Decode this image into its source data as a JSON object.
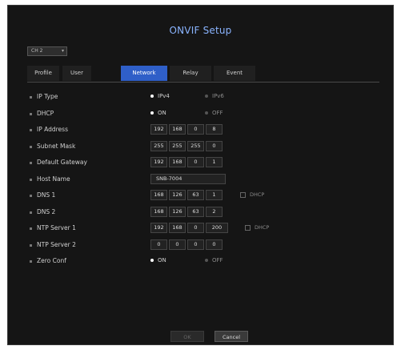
{
  "window": {
    "title": "ONVIF Setup"
  },
  "channel_select": {
    "value": "CH 2"
  },
  "tabs": [
    {
      "label": "Profile",
      "active": false
    },
    {
      "label": "User",
      "active": false
    },
    {
      "label": "Network",
      "active": true
    },
    {
      "label": "Relay",
      "active": false
    },
    {
      "label": "Event",
      "active": false
    }
  ],
  "form": {
    "ip_type": {
      "label": "IP Type",
      "opt1": "IPv4",
      "opt2": "IPv6",
      "selected": "IPv4"
    },
    "dhcp": {
      "label": "DHCP",
      "opt1": "ON",
      "opt2": "OFF",
      "selected": "ON"
    },
    "ip_address": {
      "label": "IP Address",
      "octets": [
        "192",
        "168",
        "0",
        "8"
      ]
    },
    "subnet_mask": {
      "label": "Subnet Mask",
      "octets": [
        "255",
        "255",
        "255",
        "0"
      ]
    },
    "default_gateway": {
      "label": "Default Gateway",
      "octets": [
        "192",
        "168",
        "0",
        "1"
      ]
    },
    "host_name": {
      "label": "Host Name",
      "value": "SNB-7004"
    },
    "dns1": {
      "label": "DNS 1",
      "octets": [
        "168",
        "126",
        "63",
        "1"
      ],
      "dhcp_label": "DHCP",
      "dhcp_checked": false
    },
    "dns2": {
      "label": "DNS 2",
      "octets": [
        "168",
        "126",
        "63",
        "2"
      ]
    },
    "ntp1": {
      "label": "NTP Server 1",
      "octets": [
        "192",
        "168",
        "0",
        "200"
      ],
      "dhcp_label": "DHCP",
      "dhcp_checked": false
    },
    "ntp2": {
      "label": "NTP Server 2",
      "octets": [
        "0",
        "0",
        "0",
        "0"
      ]
    },
    "zero_conf": {
      "label": "Zero Conf",
      "opt1": "ON",
      "opt2": "OFF",
      "selected": "ON"
    }
  },
  "buttons": {
    "ok": "OK",
    "cancel": "Cancel"
  },
  "colors": {
    "active_tab": "#2f5fc8",
    "title": "#8ab4ff",
    "background": "#151515"
  }
}
